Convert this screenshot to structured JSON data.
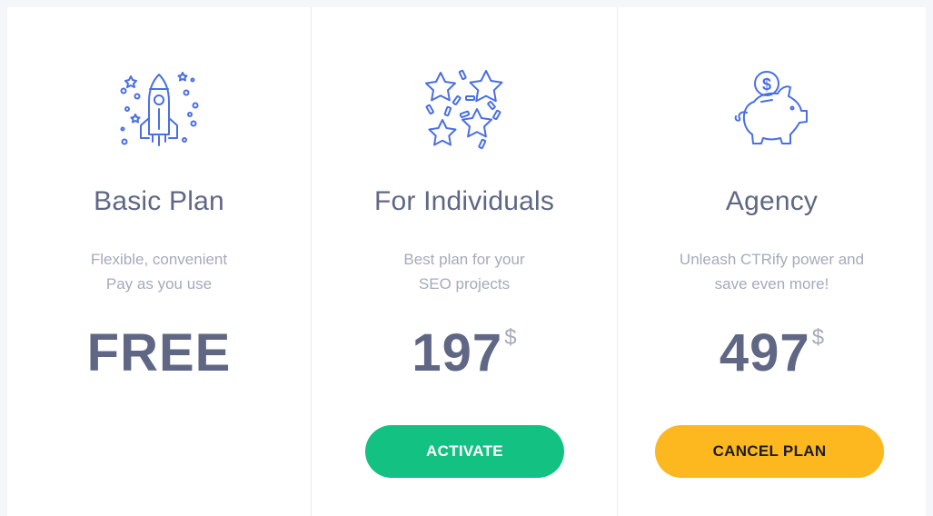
{
  "plans": [
    {
      "icon": "rocket-icon",
      "title": "Basic Plan",
      "desc_line1": "Flexible, convenient",
      "desc_line2": "Pay as you use",
      "price": "FREE",
      "currency": ""
    },
    {
      "icon": "stars-icon",
      "title": "For Individuals",
      "desc_line1": "Best plan for your",
      "desc_line2": "SEO projects",
      "price": "197",
      "currency": "$",
      "button_label": "ACTIVATE"
    },
    {
      "icon": "piggy-bank-icon",
      "title": "Agency",
      "desc_line1": "Unleash CTRify power and",
      "desc_line2": "save even more!",
      "price": "497",
      "currency": "$",
      "button_label": "CANCEL PLAN"
    }
  ],
  "colors": {
    "icon_stroke": "#4a6fe3",
    "activate_bg": "#13c183",
    "cancel_bg": "#fdb81f",
    "title_text": "#5f6785",
    "muted_text": "#a6aabb"
  }
}
